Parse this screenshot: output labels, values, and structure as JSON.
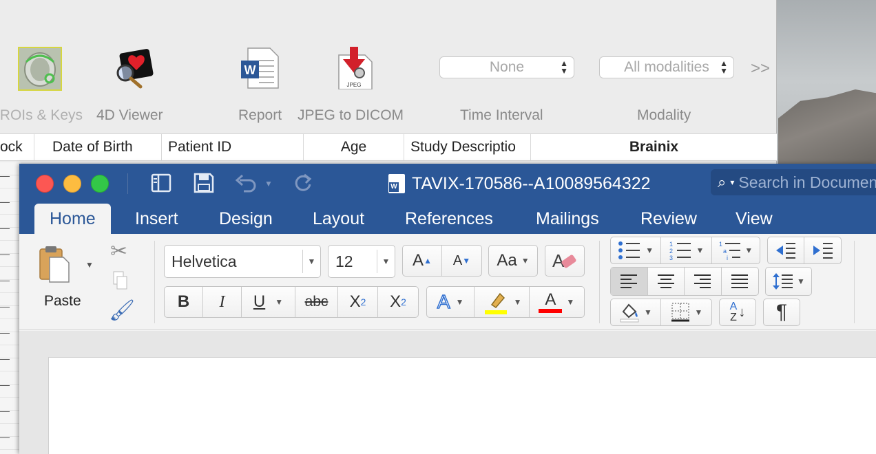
{
  "background_app": {
    "toolbar": {
      "rois_label": "ROIs & Keys",
      "viewer4d_label": "4D Viewer",
      "report_label": "Report",
      "jpeg_label": "JPEG to DICOM",
      "time_interval": {
        "value": "None",
        "label": "Time Interval"
      },
      "modality": {
        "value": "All modalities",
        "label": "Modality"
      },
      "more_label": ">>"
    },
    "columns": {
      "lock": "ock",
      "dob": "Date of Birth",
      "patient_id": "Patient ID",
      "age": "Age",
      "study": "Study Descriptio",
      "brainix": "Brainix"
    }
  },
  "word": {
    "title": "TAVIX-170586--A10089564322",
    "search_placeholder": "Search in Document",
    "accent": "#2b5797",
    "tabs": [
      {
        "label": "Home",
        "active": true
      },
      {
        "label": "Insert"
      },
      {
        "label": "Design"
      },
      {
        "label": "Layout"
      },
      {
        "label": "References"
      },
      {
        "label": "Mailings"
      },
      {
        "label": "Review"
      },
      {
        "label": "View"
      }
    ],
    "ribbon": {
      "paste_label": "Paste",
      "font_name": "Helvetica",
      "font_size": "12",
      "bold": "B",
      "italic": "I",
      "underline": "U",
      "strike": "abc",
      "sub": "X",
      "sub_mark": "2",
      "sup": "X",
      "sup_mark": "2",
      "grow": "A",
      "shrink": "A",
      "case": "Aa",
      "text_effects": "A",
      "font_color": "A",
      "para_mark": "¶",
      "sort_top": "A",
      "sort_bottom": "Z",
      "highlight_color": "#ffff00",
      "font_color_value": "#ff0000"
    }
  }
}
